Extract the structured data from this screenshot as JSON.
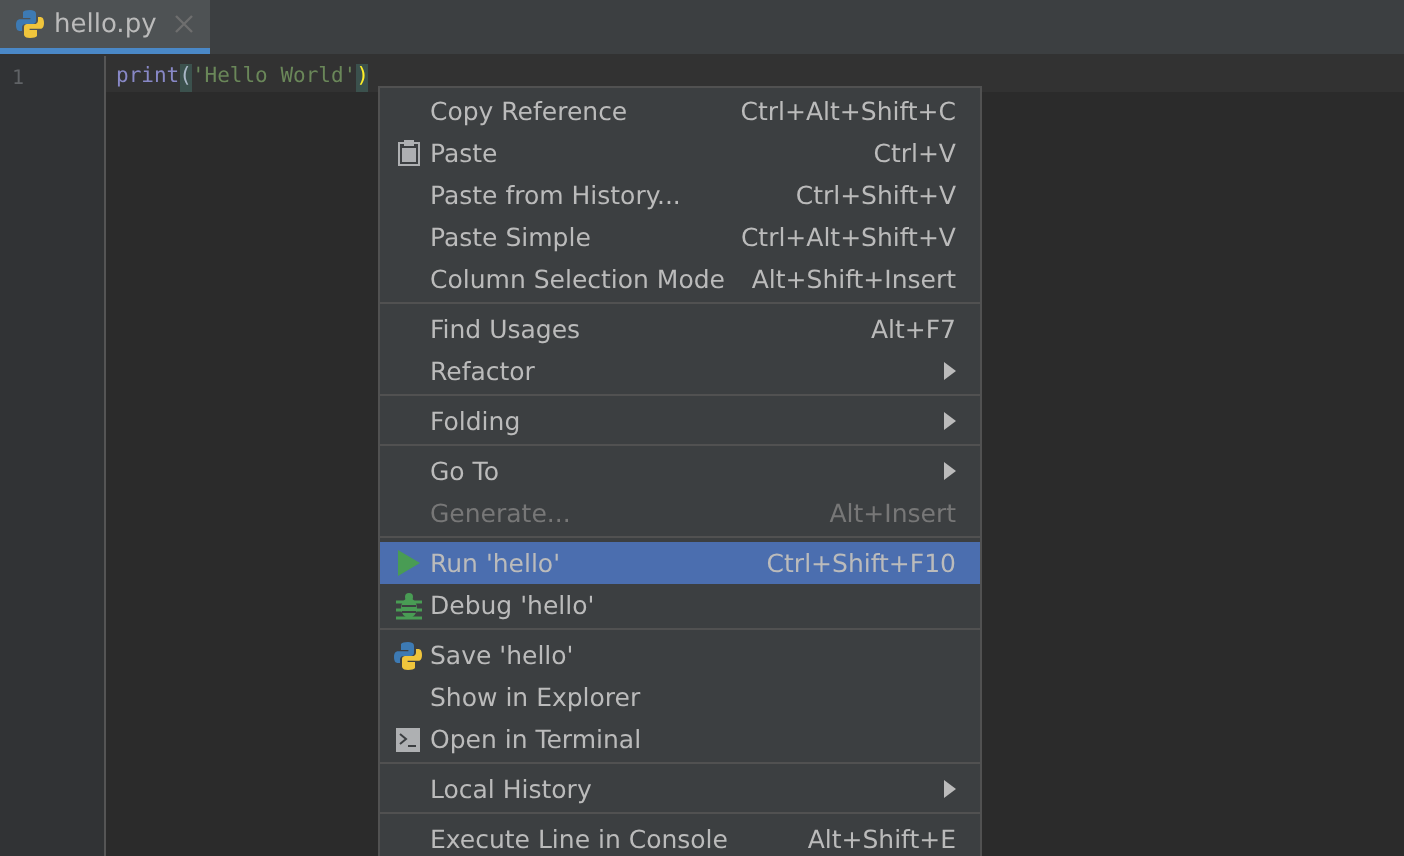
{
  "tabs": [
    {
      "label": "hello.py",
      "selected": true
    }
  ],
  "editor": {
    "line_numbers": [
      "1"
    ],
    "code": {
      "func": "print",
      "open": "(",
      "string": "'Hello World'",
      "close": ")"
    }
  },
  "context_menu": {
    "groups": [
      {
        "items": [
          {
            "label": "Copy Reference",
            "shortcut": "Ctrl+Alt+Shift+C",
            "kind": "plain",
            "submenu": false,
            "disabled": false,
            "selected": false
          },
          {
            "label": "Paste",
            "shortcut": "Ctrl+V",
            "kind": "paste",
            "submenu": false,
            "disabled": false,
            "selected": false
          },
          {
            "label": "Paste from History...",
            "shortcut": "Ctrl+Shift+V",
            "kind": "plain",
            "submenu": false,
            "disabled": false,
            "selected": false
          },
          {
            "label": "Paste Simple",
            "shortcut": "Ctrl+Alt+Shift+V",
            "kind": "plain",
            "submenu": false,
            "disabled": false,
            "selected": false
          },
          {
            "label": "Column Selection Mode",
            "shortcut": "Alt+Shift+Insert",
            "kind": "plain",
            "submenu": false,
            "disabled": false,
            "selected": false
          }
        ]
      },
      {
        "items": [
          {
            "label": "Find Usages",
            "shortcut": "Alt+F7",
            "kind": "plain",
            "submenu": false,
            "disabled": false,
            "selected": false
          },
          {
            "label": "Refactor",
            "kind": "plain",
            "submenu": true,
            "disabled": false,
            "selected": false
          }
        ]
      },
      {
        "items": [
          {
            "label": "Folding",
            "kind": "plain",
            "submenu": true,
            "disabled": false,
            "selected": false
          }
        ]
      },
      {
        "items": [
          {
            "label": "Go To",
            "kind": "plain",
            "submenu": true,
            "disabled": false,
            "selected": false
          },
          {
            "label": "Generate...",
            "shortcut": "Alt+Insert",
            "kind": "plain",
            "submenu": false,
            "disabled": true,
            "selected": false
          }
        ]
      },
      {
        "items": [
          {
            "label": "Run 'hello'",
            "shortcut": "Ctrl+Shift+F10",
            "kind": "run",
            "submenu": false,
            "disabled": false,
            "selected": true
          },
          {
            "label": "Debug 'hello'",
            "kind": "debug",
            "submenu": false,
            "disabled": false,
            "selected": false
          }
        ]
      },
      {
        "items": [
          {
            "label": "Save 'hello'",
            "kind": "python",
            "submenu": false,
            "disabled": false,
            "selected": false
          },
          {
            "label": "Show in Explorer",
            "kind": "plain",
            "submenu": false,
            "disabled": false,
            "selected": false
          },
          {
            "label": "Open in Terminal",
            "kind": "terminal",
            "submenu": false,
            "disabled": false,
            "selected": false
          }
        ]
      },
      {
        "items": [
          {
            "label": "Local History",
            "kind": "plain",
            "submenu": true,
            "disabled": false,
            "selected": false
          }
        ]
      },
      {
        "items": [
          {
            "label": "Execute Line in Console",
            "shortcut": "Alt+Shift+E",
            "kind": "plain",
            "submenu": false,
            "disabled": false,
            "selected": false
          }
        ]
      }
    ]
  }
}
